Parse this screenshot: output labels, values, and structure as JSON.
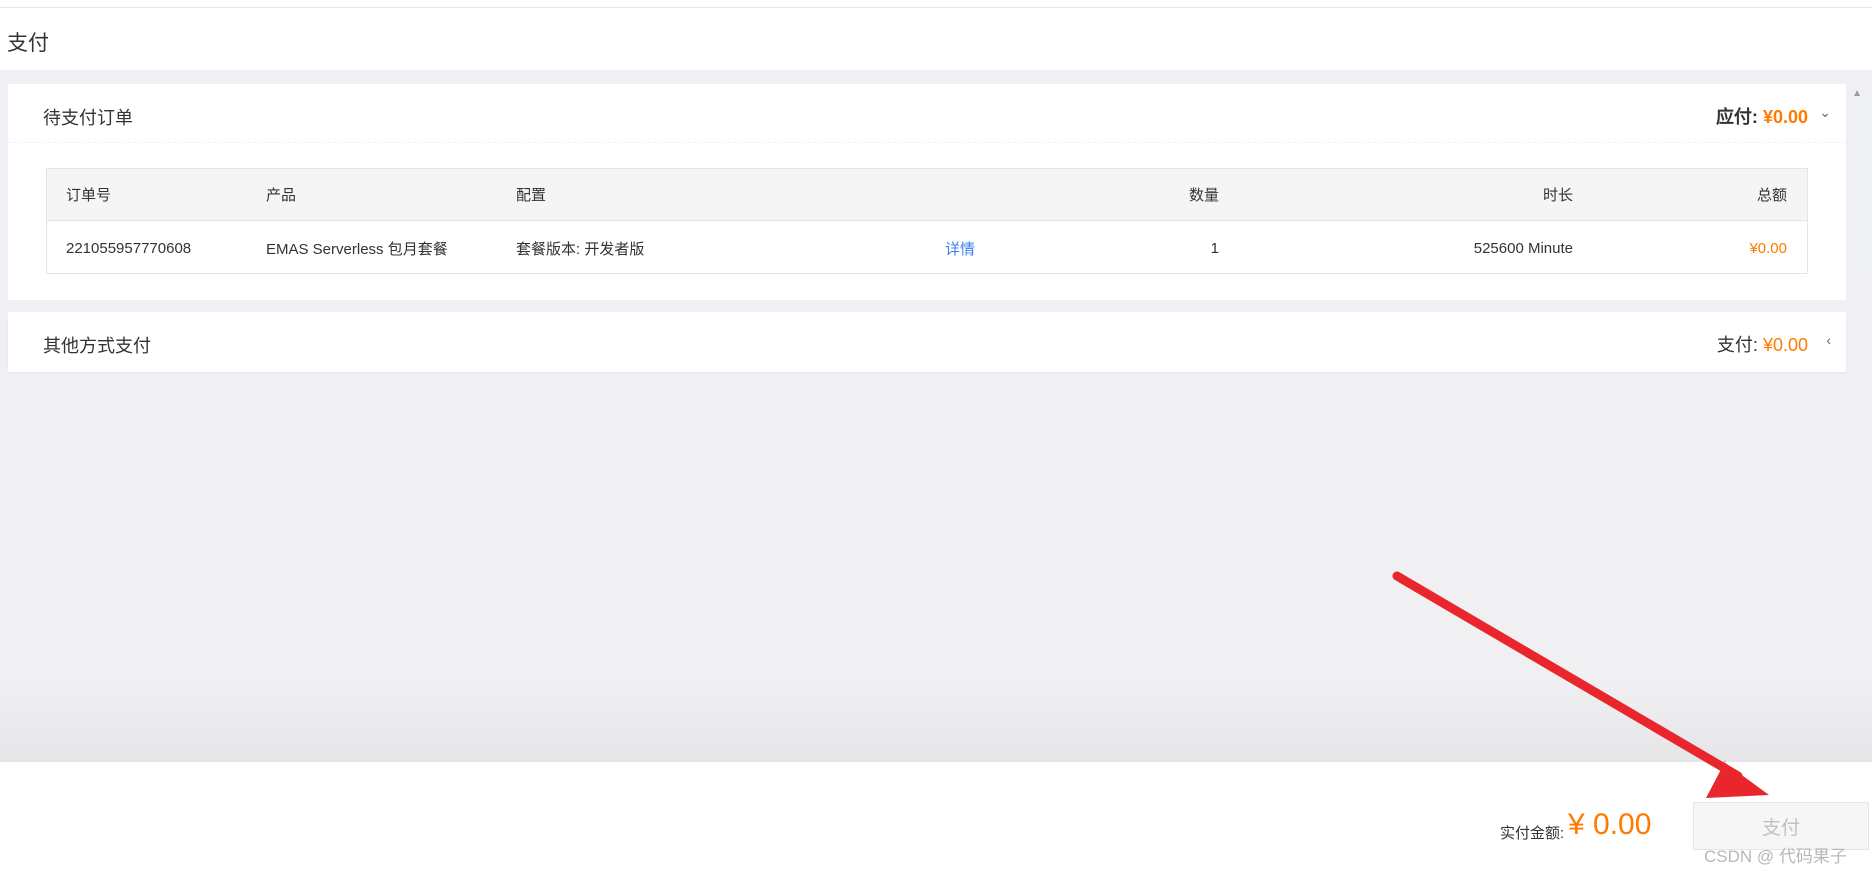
{
  "page": {
    "title": "支付"
  },
  "orders_panel": {
    "title": "待支付订单",
    "amount_label": "应付:",
    "amount_value": "¥0.00",
    "caret": "⌄",
    "table": {
      "headers": [
        "订单号",
        "产品",
        "配置",
        "数量",
        "时长",
        "总额"
      ],
      "rows": [
        {
          "order_id": "221055957770608",
          "product": "EMAS Serverless 包月套餐",
          "config": "套餐版本: 开发者版",
          "detail": "详情",
          "quantity": "1",
          "duration": "525600 Minute",
          "total": "¥0.00"
        }
      ]
    }
  },
  "other_panel": {
    "title": "其他方式支付",
    "amount_label": "支付:",
    "amount_value": "¥0.00",
    "caret": "‹"
  },
  "footer": {
    "amount_label": "实付金额:",
    "amount_value": "¥ 0.00",
    "pay_label": "支付"
  },
  "watermark": "CSDN @ 代码果子",
  "colors": {
    "accent": "#ff7a00",
    "link": "#3b7cf7",
    "annotation_arrow": "#e8262c"
  },
  "scroll_up_arrow": "▲"
}
